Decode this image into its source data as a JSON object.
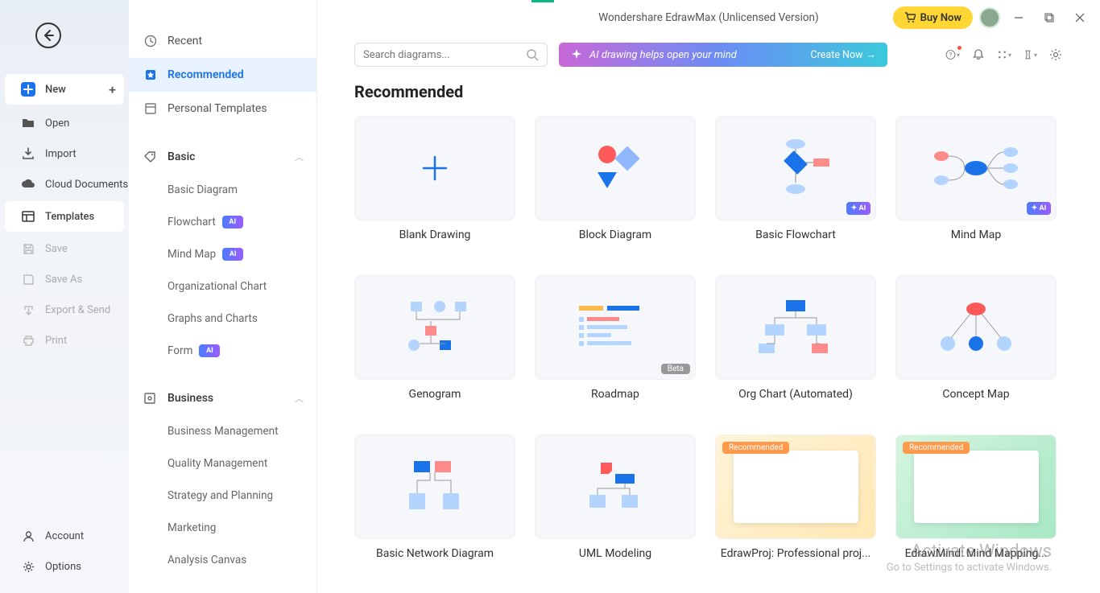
{
  "app": {
    "title": "Wondershare EdrawMax (Unlicensed Version)",
    "buy": "Buy Now"
  },
  "rail": {
    "new": "New",
    "open": "Open",
    "import": "Import",
    "cloud": "Cloud Documents",
    "templates": "Templates",
    "save": "Save",
    "saveas": "Save As",
    "export": "Export & Send",
    "print": "Print",
    "account": "Account",
    "options": "Options"
  },
  "cat": {
    "recent": "Recent",
    "recommended": "Recommended",
    "personal": "Personal Templates",
    "basic": "Basic",
    "basic_items": [
      "Basic Diagram",
      "Flowchart",
      "Mind Map",
      "Organizational Chart",
      "Graphs and Charts",
      "Form"
    ],
    "basic_ai": [
      false,
      true,
      true,
      false,
      false,
      true
    ],
    "business": "Business",
    "business_items": [
      "Business Management",
      "Quality Management",
      "Strategy and Planning",
      "Marketing",
      "Analysis Canvas"
    ]
  },
  "search": {
    "placeholder": "Search diagrams..."
  },
  "banner": {
    "text": "AI drawing helps open your mind",
    "cta": "Create Now"
  },
  "section": "Recommended",
  "cards": [
    {
      "label": "Blank Drawing",
      "ai": false,
      "beta": false
    },
    {
      "label": "Block Diagram",
      "ai": false,
      "beta": false
    },
    {
      "label": "Basic Flowchart",
      "ai": true,
      "beta": false
    },
    {
      "label": "Mind Map",
      "ai": true,
      "beta": false
    },
    {
      "label": "Genogram",
      "ai": false,
      "beta": false
    },
    {
      "label": "Roadmap",
      "ai": false,
      "beta": true
    },
    {
      "label": "Org Chart (Automated)",
      "ai": false,
      "beta": false
    },
    {
      "label": "Concept Map",
      "ai": false,
      "beta": false
    },
    {
      "label": "Basic Network Diagram",
      "ai": false,
      "beta": false
    },
    {
      "label": "UML Modeling",
      "ai": false,
      "beta": false
    },
    {
      "label": "EdrawProj: Professional proj...",
      "ai": false,
      "beta": false,
      "promo": 1,
      "rec": "Recommended"
    },
    {
      "label": "EdrawMind: Mind Mapping...",
      "ai": false,
      "beta": false,
      "promo": 2,
      "rec": "Recommended"
    }
  ],
  "badges": {
    "ai": "AI",
    "beta": "Beta"
  },
  "watermark": {
    "l1": "Activate Windows",
    "l2": "Go to Settings to activate Windows."
  }
}
